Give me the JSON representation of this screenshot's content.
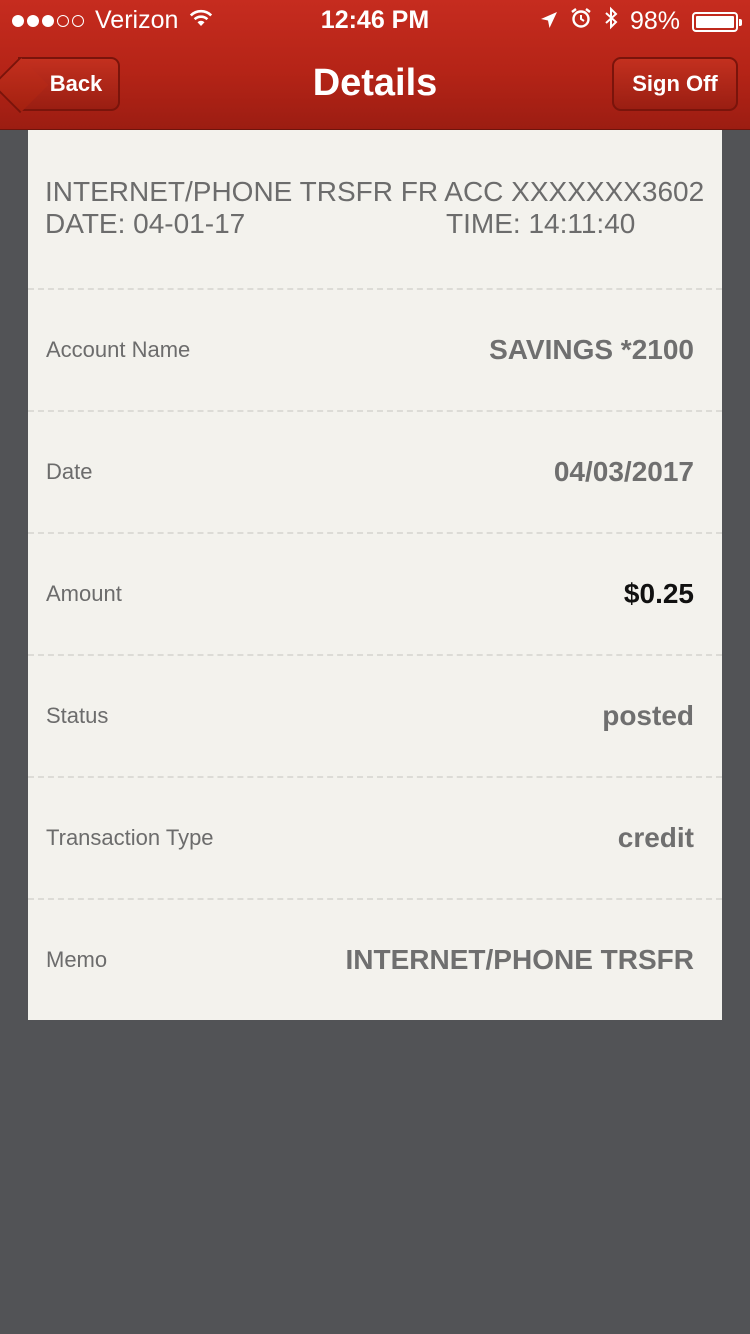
{
  "status_bar": {
    "carrier": "Verizon",
    "signal_filled": 3,
    "signal_total": 5,
    "time": "12:46 PM",
    "battery": "98%"
  },
  "nav": {
    "back_label": "Back",
    "title": "Details",
    "signoff_label": "Sign Off"
  },
  "transaction": {
    "description": "INTERNET/PHONE TRSFR FR ACC XXXXXXX3602",
    "date_line": "DATE: 04-01-17",
    "time_line": "TIME: 14:11:40"
  },
  "fields": [
    {
      "label": "Account Name",
      "value": "SAVINGS *2100"
    },
    {
      "label": "Date",
      "value": "04/03/2017"
    },
    {
      "label": "Amount",
      "value": "$0.25"
    },
    {
      "label": "Status",
      "value": "posted"
    },
    {
      "label": "Transaction Type",
      "value": "credit"
    },
    {
      "label": "Memo",
      "value": "INTERNET/PHONE TRSFR"
    }
  ],
  "colors": {
    "header": "#b52417",
    "card": "#f3f2ed",
    "background": "#525356"
  }
}
